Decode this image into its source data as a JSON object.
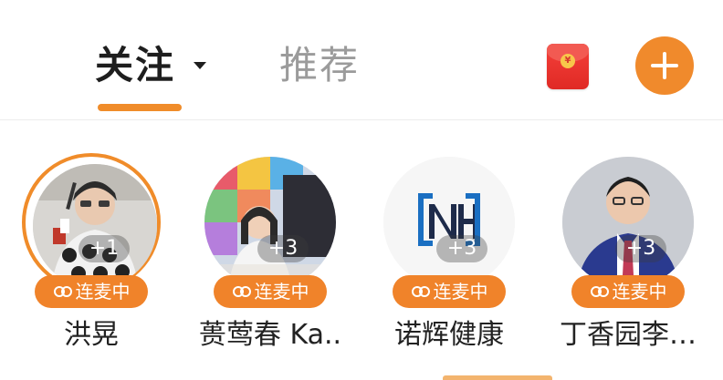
{
  "tabs": {
    "follow_label": "关注",
    "recommend_label": "推荐"
  },
  "header": {
    "red_packet_icon": "red-envelope-icon",
    "red_packet_symbol": "¥",
    "add_icon": "plus-icon"
  },
  "colors": {
    "accent": "#f08c2a",
    "red_packet": "#e02a25",
    "badge": "#f0832a"
  },
  "rooms": [
    {
      "name": "洪晃",
      "count": "+1",
      "badge": "连麦中",
      "active": true
    },
    {
      "name": "蒉莺春 Ka..",
      "count": "+3",
      "badge": "连麦中",
      "active": false
    },
    {
      "name": "诺辉健康",
      "count": "+3",
      "badge": "连麦中",
      "active": false
    },
    {
      "name": "丁香园李…",
      "count": "+3",
      "badge": "连麦中",
      "active": false
    }
  ]
}
